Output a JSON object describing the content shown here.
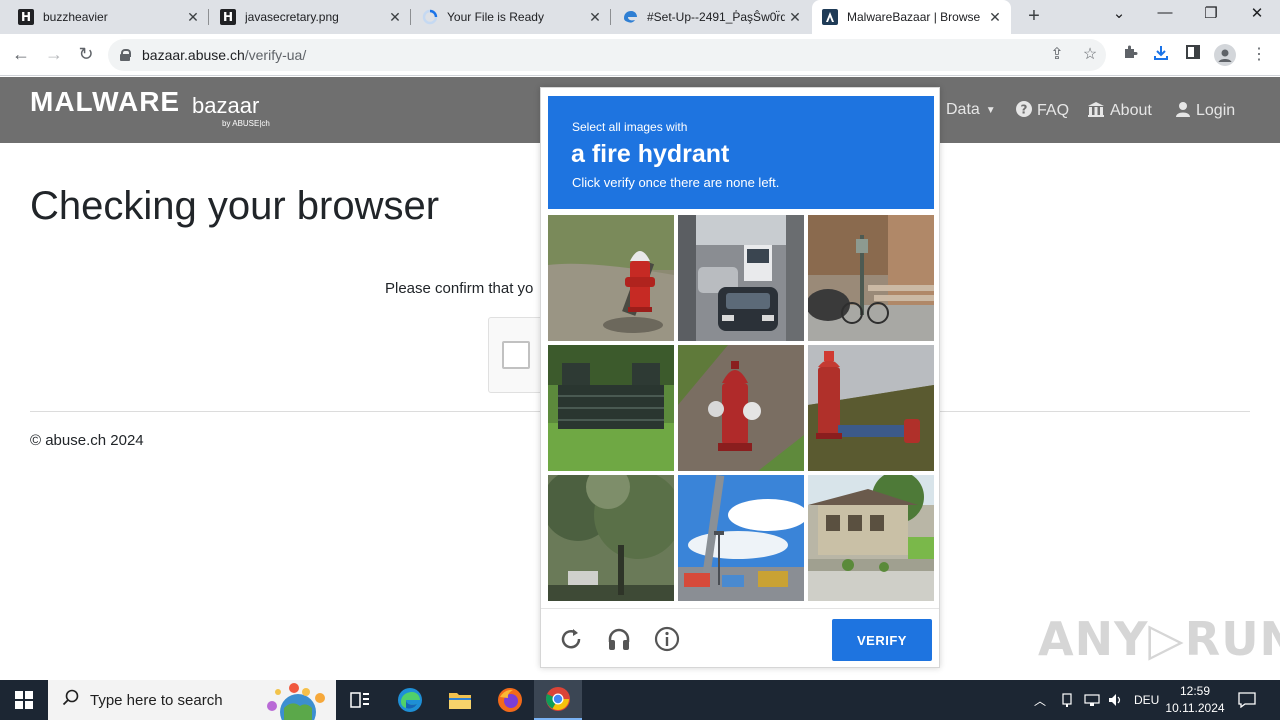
{
  "browser": {
    "tabs": [
      {
        "title": "buzzheavier",
        "favicon": "H"
      },
      {
        "title": "javasecretary.png",
        "favicon": "H"
      },
      {
        "title": "Your File is Ready",
        "favicon": "loading"
      },
      {
        "title": "#Set-Up--2491_P̓aşŜw0r̈d",
        "favicon": "edge"
      },
      {
        "title": "MalwareBazaar | Browse",
        "favicon": "malwarebazaar",
        "active": true
      }
    ],
    "url_host": "bazaar.abuse.ch",
    "url_path": "/verify-ua/"
  },
  "site": {
    "logo_main": "MALWARE",
    "logo_sub": "bazaar",
    "logo_by": "by ABUSE|ch",
    "nav": [
      {
        "label": "Data",
        "icon": "caret-down-icon"
      },
      {
        "label": "FAQ",
        "icon": "question-circle-icon"
      },
      {
        "label": "About",
        "icon": "building-icon"
      },
      {
        "label": "Login",
        "icon": "user-icon"
      }
    ],
    "page_title": "Checking your browser",
    "confirm_text": "Please confirm that yo",
    "copyright": "© abuse.ch 2024"
  },
  "captcha": {
    "prompt_pre": "Select all images with",
    "prompt_object": "a fire hydrant",
    "prompt_post": "Click verify once there are none left.",
    "verify_label": "VERIFY",
    "tiles": [
      {
        "subject": "fire hydrant on gravel"
      },
      {
        "subject": "cars on street"
      },
      {
        "subject": "stairs and bicycle"
      },
      {
        "subject": "stone wall on grass"
      },
      {
        "subject": "fire hydrant on road"
      },
      {
        "subject": "fire hydrant with pipe"
      },
      {
        "subject": "trees"
      },
      {
        "subject": "street with pole"
      },
      {
        "subject": "building and street"
      }
    ]
  },
  "watermark": "ANY▷RUN",
  "taskbar": {
    "search_placeholder": "Type here to search",
    "language": "DEU",
    "time": "12:59",
    "date": "10.11.2024"
  }
}
